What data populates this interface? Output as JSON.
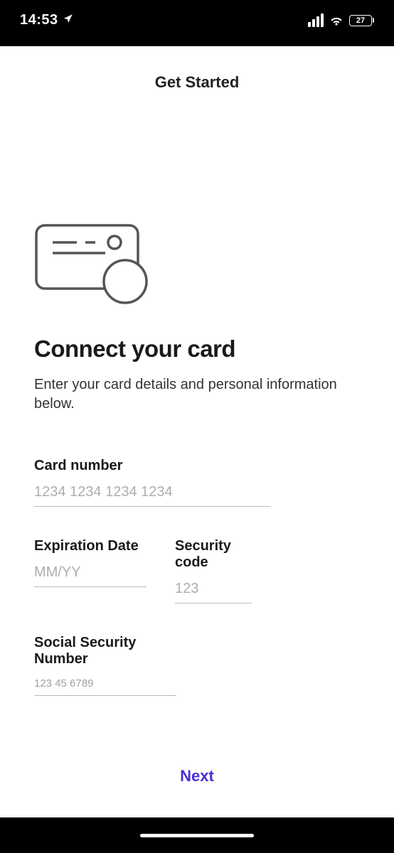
{
  "status_bar": {
    "time": "14:53",
    "battery_level": "27"
  },
  "header": {
    "title": "Get Started"
  },
  "page": {
    "heading": "Connect your card",
    "subtext": "Enter your card details and personal information below."
  },
  "form": {
    "card_number": {
      "label": "Card number",
      "placeholder": "1234 1234 1234 1234",
      "value": ""
    },
    "expiration": {
      "label": "Expiration Date",
      "placeholder": "MM/YY",
      "value": ""
    },
    "security": {
      "label": "Security code",
      "placeholder": "123",
      "value": ""
    },
    "ssn": {
      "label": "Social Security Number",
      "placeholder": "123 45 6789",
      "value": ""
    }
  },
  "actions": {
    "next_label": "Next"
  }
}
